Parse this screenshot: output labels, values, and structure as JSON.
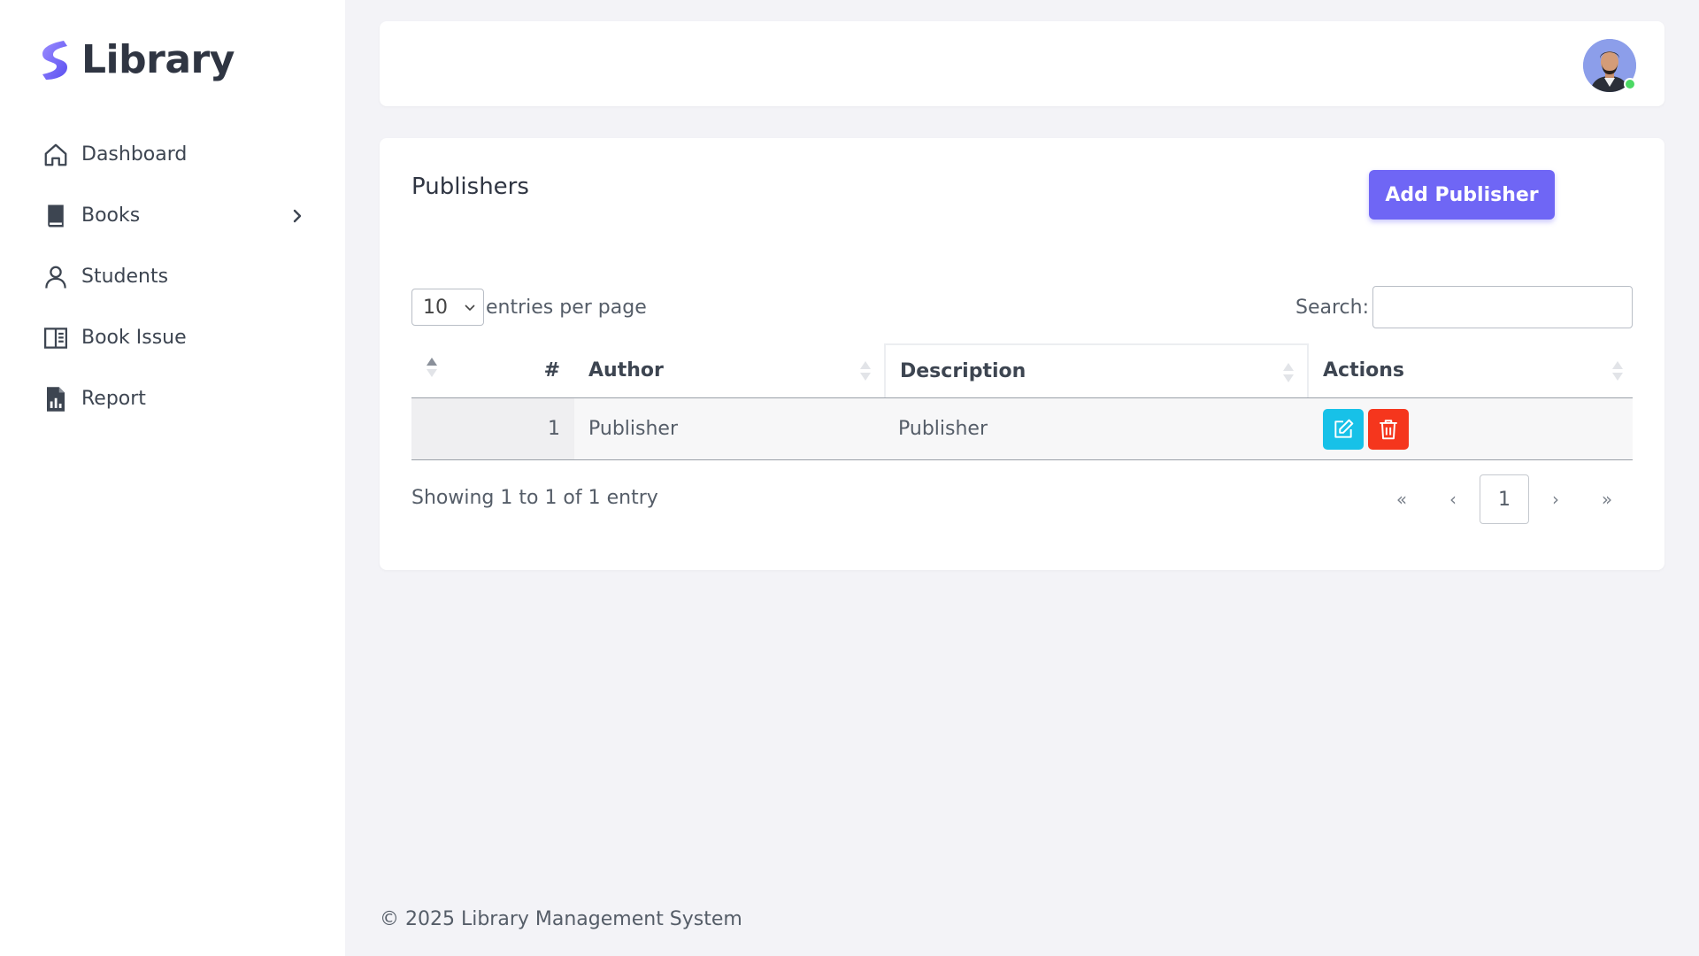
{
  "brand": {
    "name": "Library",
    "logo": "library-s-logo",
    "accent": "#6f66f5"
  },
  "sidebar": {
    "items": [
      {
        "label": "Dashboard",
        "icon": "home-icon"
      },
      {
        "label": "Books",
        "icon": "book-icon",
        "has_submenu": true
      },
      {
        "label": "Students",
        "icon": "user-icon"
      },
      {
        "label": "Book Issue",
        "icon": "book-open-icon"
      },
      {
        "label": "Report",
        "icon": "report-file-icon"
      }
    ]
  },
  "header": {
    "avatar": "user-avatar",
    "online_status_color": "#4cd964"
  },
  "page": {
    "title": "Publishers",
    "add_button": "Add Publisher",
    "length_value": "10",
    "length_label": "entries per page",
    "search_label": "Search:",
    "search_value": ""
  },
  "table": {
    "columns": [
      "#",
      "Author",
      "Description",
      "Actions"
    ],
    "rows": [
      {
        "num": "1",
        "author": "Publisher",
        "description": "Publisher"
      }
    ],
    "info": "Showing 1 to 1 of 1 entry",
    "pagination": {
      "first": "«",
      "prev": "‹",
      "current": "1",
      "next": "›",
      "last": "»"
    }
  },
  "colors": {
    "edit": "#17c1e8",
    "delete": "#f5361d"
  },
  "footer": {
    "text": "© 2025 Library Management System"
  }
}
